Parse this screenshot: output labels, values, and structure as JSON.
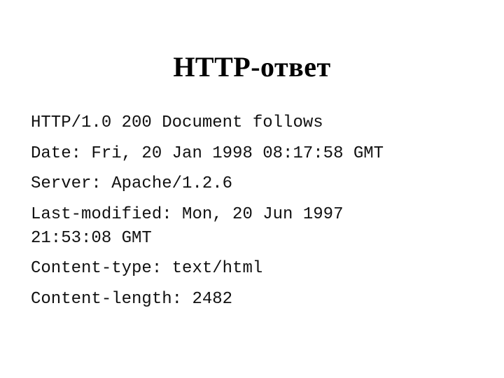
{
  "slide": {
    "title": "HTTP-ответ",
    "lines": [
      "HTTP/1.0 200 Document follows",
      "Date: Fri, 20 Jan 1998 08:17:58 GMT",
      "Server: Apache/1.2.6",
      "Last-modified: Mon, 20 Jun 1997",
      "21:53:08 GMT",
      "Content-type: text/html",
      "Content-length: 2482"
    ]
  }
}
